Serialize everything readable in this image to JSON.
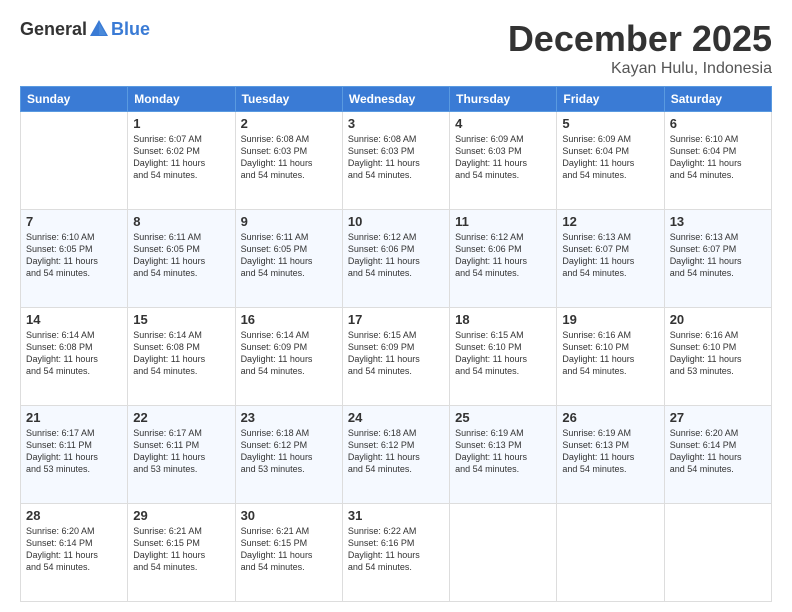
{
  "logo": {
    "general": "General",
    "blue": "Blue"
  },
  "header": {
    "month": "December 2025",
    "location": "Kayan Hulu, Indonesia"
  },
  "weekdays": [
    "Sunday",
    "Monday",
    "Tuesday",
    "Wednesday",
    "Thursday",
    "Friday",
    "Saturday"
  ],
  "weeks": [
    [
      {
        "day": "",
        "info": ""
      },
      {
        "day": "1",
        "info": "Sunrise: 6:07 AM\nSunset: 6:02 PM\nDaylight: 11 hours\nand 54 minutes."
      },
      {
        "day": "2",
        "info": "Sunrise: 6:08 AM\nSunset: 6:03 PM\nDaylight: 11 hours\nand 54 minutes."
      },
      {
        "day": "3",
        "info": "Sunrise: 6:08 AM\nSunset: 6:03 PM\nDaylight: 11 hours\nand 54 minutes."
      },
      {
        "day": "4",
        "info": "Sunrise: 6:09 AM\nSunset: 6:03 PM\nDaylight: 11 hours\nand 54 minutes."
      },
      {
        "day": "5",
        "info": "Sunrise: 6:09 AM\nSunset: 6:04 PM\nDaylight: 11 hours\nand 54 minutes."
      },
      {
        "day": "6",
        "info": "Sunrise: 6:10 AM\nSunset: 6:04 PM\nDaylight: 11 hours\nand 54 minutes."
      }
    ],
    [
      {
        "day": "7",
        "info": "Sunrise: 6:10 AM\nSunset: 6:05 PM\nDaylight: 11 hours\nand 54 minutes."
      },
      {
        "day": "8",
        "info": "Sunrise: 6:11 AM\nSunset: 6:05 PM\nDaylight: 11 hours\nand 54 minutes."
      },
      {
        "day": "9",
        "info": "Sunrise: 6:11 AM\nSunset: 6:05 PM\nDaylight: 11 hours\nand 54 minutes."
      },
      {
        "day": "10",
        "info": "Sunrise: 6:12 AM\nSunset: 6:06 PM\nDaylight: 11 hours\nand 54 minutes."
      },
      {
        "day": "11",
        "info": "Sunrise: 6:12 AM\nSunset: 6:06 PM\nDaylight: 11 hours\nand 54 minutes."
      },
      {
        "day": "12",
        "info": "Sunrise: 6:13 AM\nSunset: 6:07 PM\nDaylight: 11 hours\nand 54 minutes."
      },
      {
        "day": "13",
        "info": "Sunrise: 6:13 AM\nSunset: 6:07 PM\nDaylight: 11 hours\nand 54 minutes."
      }
    ],
    [
      {
        "day": "14",
        "info": "Sunrise: 6:14 AM\nSunset: 6:08 PM\nDaylight: 11 hours\nand 54 minutes."
      },
      {
        "day": "15",
        "info": "Sunrise: 6:14 AM\nSunset: 6:08 PM\nDaylight: 11 hours\nand 54 minutes."
      },
      {
        "day": "16",
        "info": "Sunrise: 6:14 AM\nSunset: 6:09 PM\nDaylight: 11 hours\nand 54 minutes."
      },
      {
        "day": "17",
        "info": "Sunrise: 6:15 AM\nSunset: 6:09 PM\nDaylight: 11 hours\nand 54 minutes."
      },
      {
        "day": "18",
        "info": "Sunrise: 6:15 AM\nSunset: 6:10 PM\nDaylight: 11 hours\nand 54 minutes."
      },
      {
        "day": "19",
        "info": "Sunrise: 6:16 AM\nSunset: 6:10 PM\nDaylight: 11 hours\nand 54 minutes."
      },
      {
        "day": "20",
        "info": "Sunrise: 6:16 AM\nSunset: 6:10 PM\nDaylight: 11 hours\nand 53 minutes."
      }
    ],
    [
      {
        "day": "21",
        "info": "Sunrise: 6:17 AM\nSunset: 6:11 PM\nDaylight: 11 hours\nand 53 minutes."
      },
      {
        "day": "22",
        "info": "Sunrise: 6:17 AM\nSunset: 6:11 PM\nDaylight: 11 hours\nand 53 minutes."
      },
      {
        "day": "23",
        "info": "Sunrise: 6:18 AM\nSunset: 6:12 PM\nDaylight: 11 hours\nand 53 minutes."
      },
      {
        "day": "24",
        "info": "Sunrise: 6:18 AM\nSunset: 6:12 PM\nDaylight: 11 hours\nand 54 minutes."
      },
      {
        "day": "25",
        "info": "Sunrise: 6:19 AM\nSunset: 6:13 PM\nDaylight: 11 hours\nand 54 minutes."
      },
      {
        "day": "26",
        "info": "Sunrise: 6:19 AM\nSunset: 6:13 PM\nDaylight: 11 hours\nand 54 minutes."
      },
      {
        "day": "27",
        "info": "Sunrise: 6:20 AM\nSunset: 6:14 PM\nDaylight: 11 hours\nand 54 minutes."
      }
    ],
    [
      {
        "day": "28",
        "info": "Sunrise: 6:20 AM\nSunset: 6:14 PM\nDaylight: 11 hours\nand 54 minutes."
      },
      {
        "day": "29",
        "info": "Sunrise: 6:21 AM\nSunset: 6:15 PM\nDaylight: 11 hours\nand 54 minutes."
      },
      {
        "day": "30",
        "info": "Sunrise: 6:21 AM\nSunset: 6:15 PM\nDaylight: 11 hours\nand 54 minutes."
      },
      {
        "day": "31",
        "info": "Sunrise: 6:22 AM\nSunset: 6:16 PM\nDaylight: 11 hours\nand 54 minutes."
      },
      {
        "day": "",
        "info": ""
      },
      {
        "day": "",
        "info": ""
      },
      {
        "day": "",
        "info": ""
      }
    ]
  ]
}
